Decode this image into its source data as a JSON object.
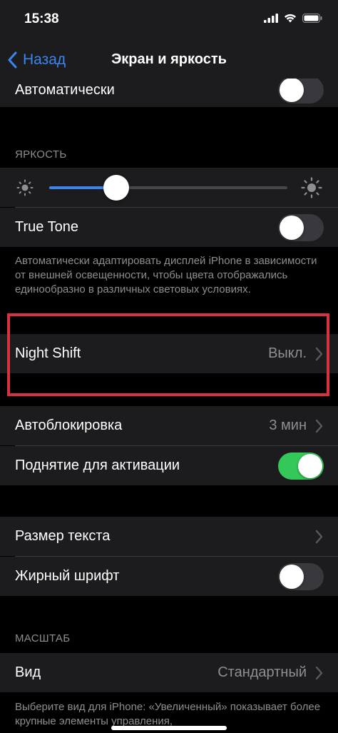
{
  "status": {
    "time": "15:38"
  },
  "nav": {
    "back_label": "Назад",
    "title": "Экран и яркость"
  },
  "rows": {
    "auto_label": "Автоматически",
    "brightness_header": "ЯРКОСТЬ",
    "brightness_level": 0.28,
    "true_tone_label": "True Tone",
    "true_tone_footer": "Автоматически адаптировать дисплей iPhone в зависимости от внешней освещенности, чтобы цвета отображались единообразно в различных световых условиях.",
    "night_shift_label": "Night Shift",
    "night_shift_value": "Выкл.",
    "auto_lock_label": "Автоблокировка",
    "auto_lock_value": "3 мин",
    "raise_to_wake_label": "Поднятие для активации",
    "text_size_label": "Размер текста",
    "bold_text_label": "Жирный шрифт",
    "zoom_header": "МАСШТАБ",
    "view_label": "Вид",
    "view_value": "Стандартный",
    "view_footer": "Выберите вид для iPhone: «Увеличенный» показывает более крупные элементы управления,"
  },
  "toggles": {
    "auto": false,
    "true_tone": false,
    "raise_to_wake": true,
    "bold_text": false
  },
  "colors": {
    "accent": "#3a86f0",
    "toggle_on": "#34c759",
    "highlight": "#d7323f"
  },
  "icons": {
    "status": [
      "cellular-signal-icon",
      "wifi-icon",
      "battery-icon"
    ],
    "brightness": [
      "sun-small-icon",
      "sun-large-icon"
    ],
    "chevron": "chevron-right-icon"
  }
}
